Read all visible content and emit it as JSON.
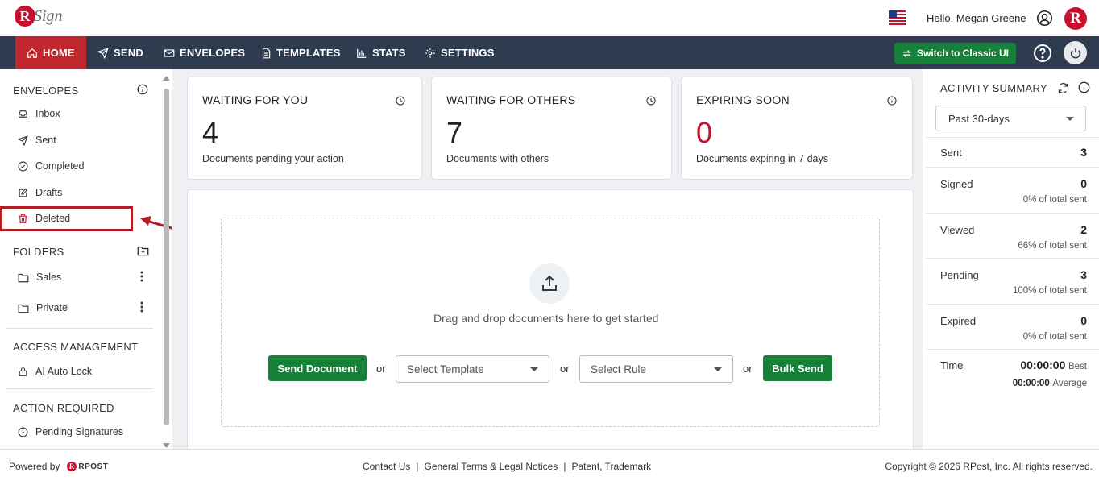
{
  "header": {
    "logo_text": "Sign",
    "logo_letter": "R",
    "greeting": "Hello, Megan Greene",
    "brand_letter": "R"
  },
  "nav": {
    "items": [
      {
        "label": "HOME",
        "icon": "home-icon",
        "active": true
      },
      {
        "label": "SEND",
        "icon": "send-icon"
      },
      {
        "label": "ENVELOPES",
        "icon": "envelope-icon"
      },
      {
        "label": "TEMPLATES",
        "icon": "document-icon"
      },
      {
        "label": "STATS",
        "icon": "bar-chart-icon"
      },
      {
        "label": "SETTINGS",
        "icon": "gear-icon"
      }
    ],
    "classic_button": "Switch to Classic UI"
  },
  "sidebar": {
    "envelopes_title": "ENVELOPES",
    "envelope_items": [
      {
        "label": "Inbox",
        "icon": "inbox-icon"
      },
      {
        "label": "Sent",
        "icon": "send-icon"
      },
      {
        "label": "Completed",
        "icon": "check-circle-icon"
      },
      {
        "label": "Drafts",
        "icon": "edit-icon"
      },
      {
        "label": "Deleted",
        "icon": "trash-icon"
      }
    ],
    "folders_title": "FOLDERS",
    "folder_items": [
      {
        "label": "Sales",
        "icon": "folder-icon"
      },
      {
        "label": "Private",
        "icon": "folder-icon"
      }
    ],
    "access_title": "ACCESS MANAGEMENT",
    "access_items": [
      {
        "label": "AI Auto Lock",
        "icon": "lock-icon"
      }
    ],
    "action_title": "ACTION REQUIRED",
    "action_items": [
      {
        "label": "Pending Signatures",
        "icon": "clock-icon"
      }
    ]
  },
  "cards": [
    {
      "title": "WAITING FOR YOU",
      "value": "4",
      "subtitle": "Documents pending your action"
    },
    {
      "title": "WAITING FOR OTHERS",
      "value": "7",
      "subtitle": "Documents with others"
    },
    {
      "title": "EXPIRING SOON",
      "value": "0",
      "subtitle": "Documents expiring in 7 days",
      "value_color": "#c8102e"
    }
  ],
  "upload": {
    "drag_text": "Drag and drop documents here to get started",
    "send_button": "Send Document",
    "or_text": "or",
    "template_placeholder": "Select Template",
    "rule_placeholder": "Select Rule",
    "bulk_button": "Bulk Send"
  },
  "activity": {
    "title": "ACTIVITY SUMMARY",
    "period": "Past 30-days",
    "rows": [
      {
        "label": "Sent",
        "value": "3",
        "pct": ""
      },
      {
        "label": "Signed",
        "value": "0",
        "pct": "0% of total sent"
      },
      {
        "label": "Viewed",
        "value": "2",
        "pct": "66% of total sent"
      },
      {
        "label": "Pending",
        "value": "3",
        "pct": "100% of total sent"
      },
      {
        "label": "Expired",
        "value": "0",
        "pct": "0% of total sent"
      }
    ],
    "time_label": "Time",
    "time_best_value": "00:00:00",
    "time_best_label": "Best",
    "time_avg_value": "00:00:00",
    "time_avg_label": "Average"
  },
  "footer": {
    "powered_by": "Powered by",
    "rpost_letter": "R",
    "rpost_text": "RPOST",
    "links": [
      "Contact Us",
      "General Terms & Legal Notices",
      "Patent, Trademark"
    ],
    "copyright": "Copyright © 2026 RPost, Inc. All rights reserved."
  },
  "colors": {
    "nav_bg": "#2f3b4e",
    "active_red": "#c0282d",
    "brand_green": "#17813a",
    "highlight": "#b01e23"
  }
}
